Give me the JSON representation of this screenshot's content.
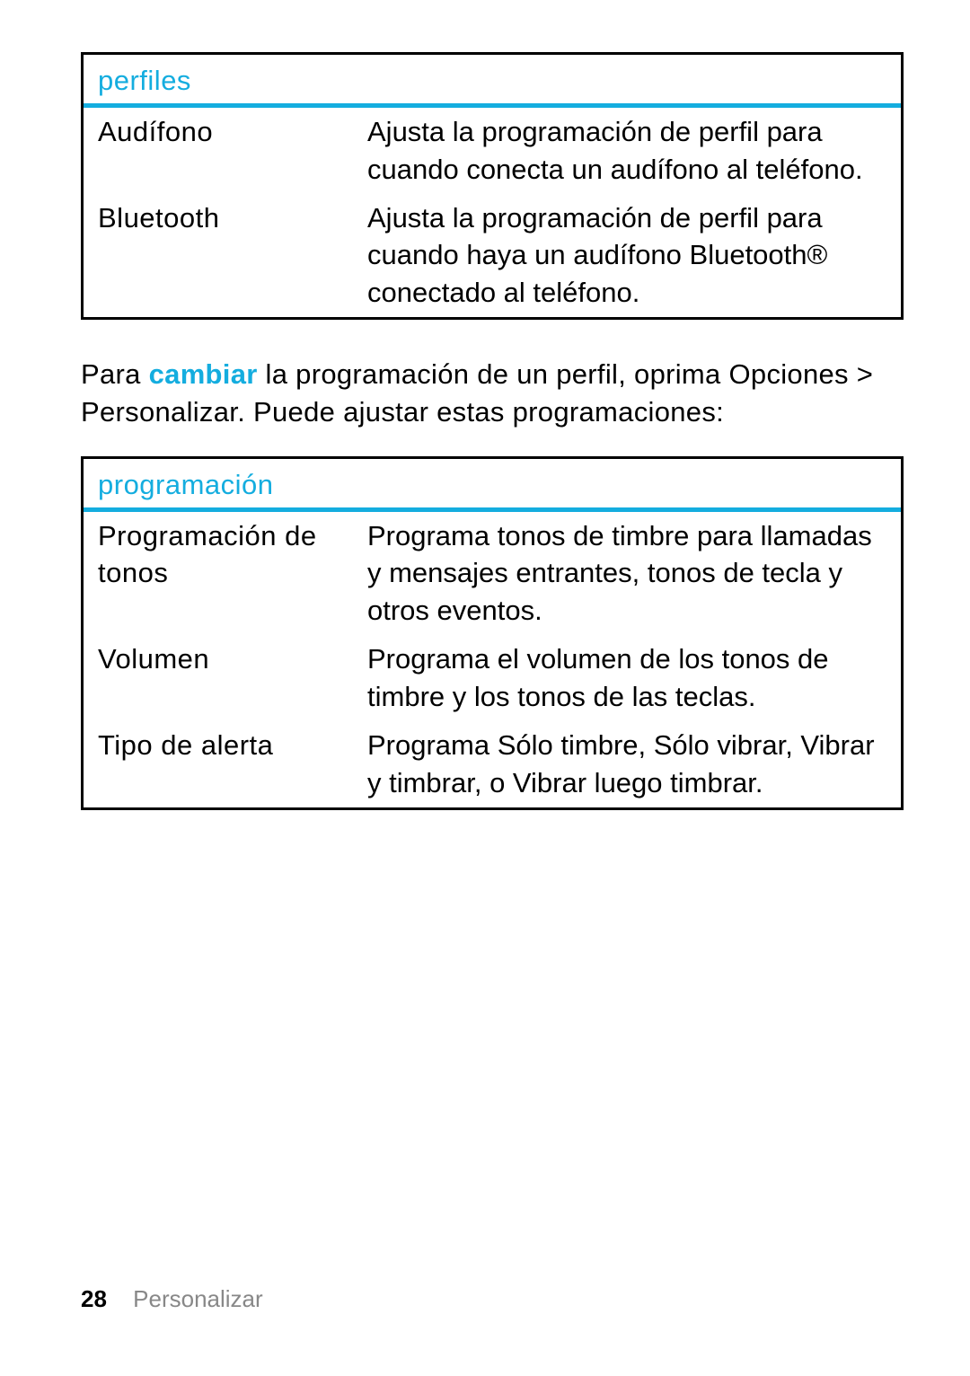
{
  "tables": {
    "perfiles": {
      "title": "perfiles",
      "rows": [
        {
          "name": "Audífono",
          "desc": "Ajusta la programación de perfil para cuando conecta un audífono al teléfono."
        },
        {
          "name": "Bluetooth",
          "desc": "Ajusta la programación de perfil para cuando haya un audífono Bluetooth® conectado al teléfono."
        }
      ]
    },
    "programacion": {
      "title": "programación",
      "rows": [
        {
          "name": "Programación de tonos",
          "desc": "Programa tonos de timbre para llamadas y mensajes entrantes, tonos de tecla y otros eventos."
        },
        {
          "name": "Volumen",
          "desc": "Programa el volumen de los tonos de timbre y los tonos de las teclas."
        },
        {
          "name": "Tipo de alerta",
          "desc": "Programa Sólo timbre, Sólo vibrar, Vibrar y timbrar, o Vibrar luego timbrar."
        }
      ]
    }
  },
  "paragraph": {
    "lead": "Para ",
    "accent": "cambiar",
    "rest": " la programación de un perfil, oprima Opciones > Personalizar. Puede ajustar estas programaciones:"
  },
  "footer": {
    "page": "28",
    "section": "Personalizar"
  }
}
